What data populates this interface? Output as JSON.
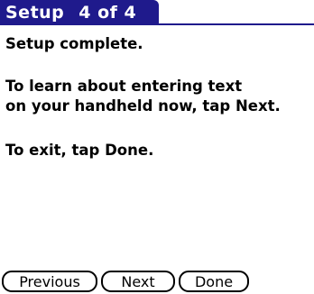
{
  "titlebar": {
    "title": "Setup",
    "step": "4 of 4",
    "accent_color": "#1f1a8c"
  },
  "content": {
    "line1": "Setup complete.",
    "line2a": "To learn about entering text",
    "line2b": "on your handheld now, tap Next.",
    "line3": "To exit, tap Done."
  },
  "buttons": {
    "previous": "Previous",
    "next": "Next",
    "done": "Done"
  }
}
